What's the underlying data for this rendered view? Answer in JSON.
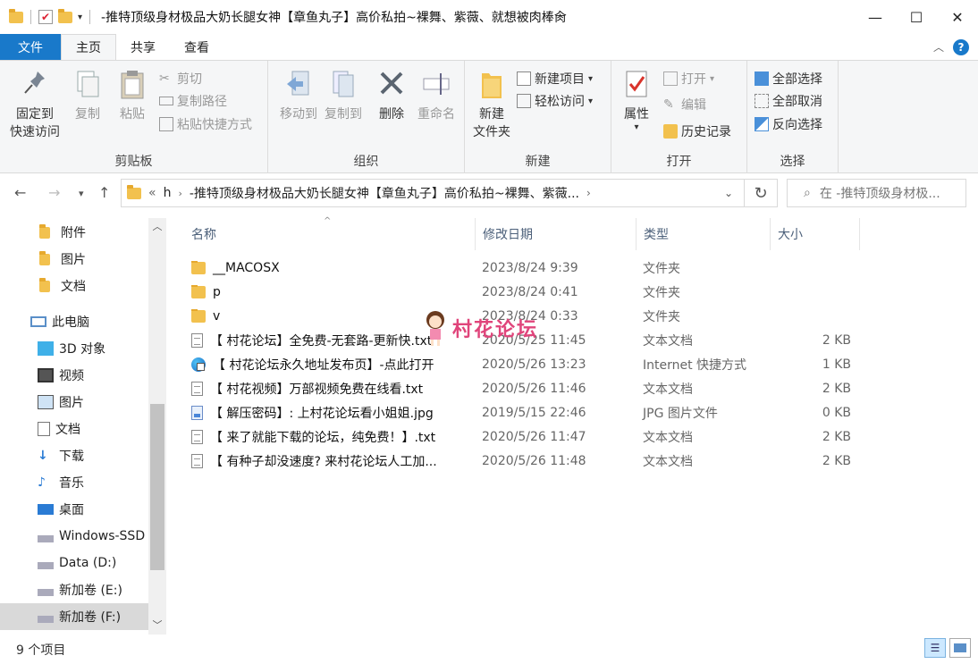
{
  "window": {
    "title": "-推特顶级身材极品大奶长腿女神【章鱼丸子】高价私拍~裸舞、紫薇、就想被肉棒肏",
    "minimize": "—",
    "maximize": "☐",
    "close": "✕"
  },
  "ribbon_tabs": [
    {
      "label": "文件"
    },
    {
      "label": "主页"
    },
    {
      "label": "共享"
    },
    {
      "label": "查看"
    }
  ],
  "ribbon": {
    "clipboard": {
      "label": "剪贴板",
      "pin": "固定到\n快速访问",
      "pin_line1": "固定到",
      "pin_line2": "快速访问",
      "copy": "复制",
      "paste": "粘贴",
      "cut": "剪切",
      "copy_path": "复制路径",
      "paste_shortcut": "粘贴快捷方式"
    },
    "organize": {
      "label": "组织",
      "move_to": "移动到",
      "copy_to": "复制到",
      "delete": "删除",
      "rename": "重命名"
    },
    "new": {
      "label": "新建",
      "new_folder_line1": "新建",
      "new_folder_line2": "文件夹",
      "new_item": "新建项目",
      "easy_access": "轻松访问"
    },
    "open": {
      "label": "打开",
      "properties": "属性",
      "open": "打开",
      "edit": "编辑",
      "history": "历史记录"
    },
    "select": {
      "label": "选择",
      "select_all": "全部选择",
      "select_none": "全部取消",
      "invert": "反向选择"
    }
  },
  "address": {
    "path_prefix": "«",
    "path_h": "h",
    "path_folder": "-推特顶级身材极品大奶长腿女神【章鱼丸子】高价私拍~裸舞、紫薇...",
    "search_placeholder": "在 -推特顶级身材极..."
  },
  "nav": [
    {
      "label": "附件",
      "icon": "folder-icon"
    },
    {
      "label": "图片",
      "icon": "folder-icon"
    },
    {
      "label": "文档",
      "icon": "folder-icon"
    },
    {
      "label": "此电脑",
      "icon": "computer-icon"
    },
    {
      "label": "3D 对象",
      "icon": "3d-objects-icon"
    },
    {
      "label": "视频",
      "icon": "video-icon"
    },
    {
      "label": "图片",
      "icon": "pictures-icon"
    },
    {
      "label": "文档",
      "icon": "documents-icon"
    },
    {
      "label": "下载",
      "icon": "download-icon"
    },
    {
      "label": "音乐",
      "icon": "music-icon"
    },
    {
      "label": "桌面",
      "icon": "desktop-icon"
    },
    {
      "label": "Windows-SSD",
      "icon": "drive-icon"
    },
    {
      "label": "Data (D:)",
      "icon": "drive-icon"
    },
    {
      "label": "新加卷 (E:)",
      "icon": "drive-icon"
    },
    {
      "label": "新加卷 (F:)",
      "icon": "drive-icon"
    }
  ],
  "columns": {
    "name": "名称",
    "date": "修改日期",
    "type": "类型",
    "size": "大小"
  },
  "files": [
    {
      "name": "__MACOSX",
      "date": "2023/8/24 9:39",
      "type": "文件夹",
      "size": "",
      "icon": "folder-icon"
    },
    {
      "name": "p",
      "date": "2023/8/24 0:41",
      "type": "文件夹",
      "size": "",
      "icon": "folder-icon"
    },
    {
      "name": "v",
      "date": "2023/8/24 0:33",
      "type": "文件夹",
      "size": "",
      "icon": "folder-icon"
    },
    {
      "name": "【 村花论坛】全免费-无套路-更新快.txt",
      "date": "2020/5/25 11:45",
      "type": "文本文档",
      "size": "2 KB",
      "icon": "text-file-icon"
    },
    {
      "name": "【 村花论坛永久地址发布页】-点此打开",
      "date": "2020/5/26 13:23",
      "type": "Internet 快捷方式",
      "size": "1 KB",
      "icon": "internet-shortcut-icon"
    },
    {
      "name": "【 村花视频】万部视频免费在线看.txt",
      "date": "2020/5/26 11:46",
      "type": "文本文档",
      "size": "2 KB",
      "icon": "text-file-icon"
    },
    {
      "name": "【 解压密码】: 上村花论坛看小姐姐.jpg",
      "date": "2019/5/15 22:46",
      "type": "JPG 图片文件",
      "size": "0 KB",
      "icon": "image-file-icon"
    },
    {
      "name": "【 来了就能下载的论坛，纯免费！】.txt",
      "date": "2020/5/26 11:47",
      "type": "文本文档",
      "size": "2 KB",
      "icon": "text-file-icon"
    },
    {
      "name": "【 有种子却没速度? 来村花论坛人工加...",
      "date": "2020/5/26 11:48",
      "type": "文本文档",
      "size": "2 KB",
      "icon": "text-file-icon"
    }
  ],
  "watermark": {
    "text": "村花论坛"
  },
  "status": {
    "count": "9 个项目"
  }
}
